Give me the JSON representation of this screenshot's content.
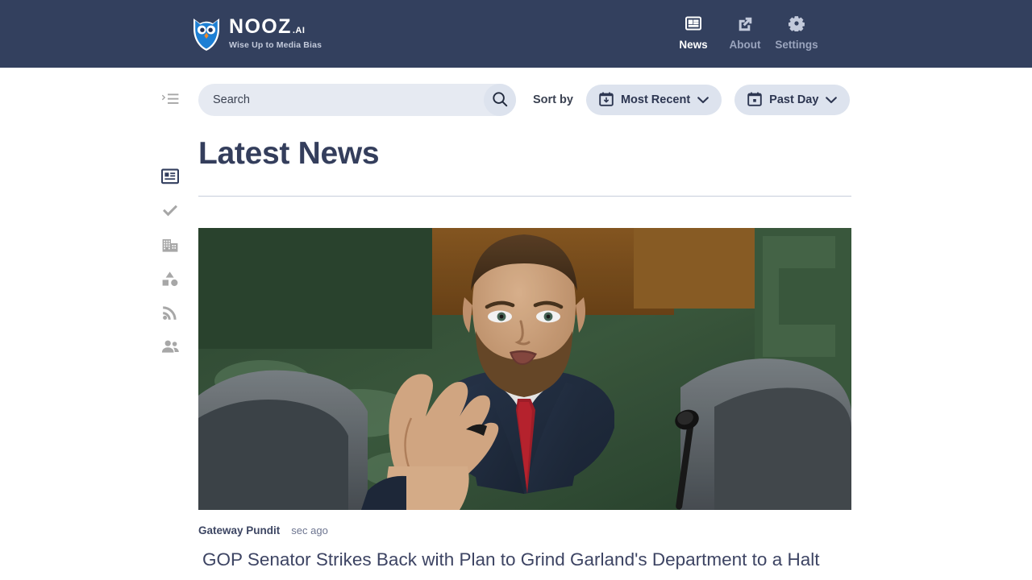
{
  "header": {
    "logo": {
      "icon": "owl-icon",
      "word": "NOOZ",
      "suffix": ".AI",
      "tagline": "Wise Up to Media Bias"
    },
    "nav": [
      {
        "label": "News",
        "icon": "article-feed-icon",
        "active": true
      },
      {
        "label": "About",
        "icon": "external-link-icon",
        "active": false
      },
      {
        "label": "Settings",
        "icon": "gear-icon",
        "active": false
      }
    ]
  },
  "sidebar": {
    "items": [
      {
        "name": "menu-expand",
        "icon": "menu-expand-icon",
        "active": false
      },
      {
        "name": "news",
        "icon": "article-feed-icon",
        "active": true
      },
      {
        "name": "fact-check",
        "icon": "checkmark-icon",
        "active": false
      },
      {
        "name": "organizations",
        "icon": "building-icon",
        "active": false
      },
      {
        "name": "topics",
        "icon": "shapes-icon",
        "active": false
      },
      {
        "name": "feeds",
        "icon": "rss-icon",
        "active": false
      },
      {
        "name": "people",
        "icon": "people-group-icon",
        "active": false
      }
    ]
  },
  "toolbar": {
    "search": {
      "placeholder": "Search",
      "value": "",
      "button_icon": "search-icon"
    },
    "sort_by_label": "Sort by",
    "sort_dropdown": {
      "value": "Most Recent",
      "icon": "calendar-sort-icon",
      "chevron": "chevron-down-icon"
    },
    "date_dropdown": {
      "value": "Past Day",
      "icon": "calendar-icon",
      "chevron": "chevron-down-icon"
    }
  },
  "main": {
    "page_title": "Latest News",
    "articles": [
      {
        "source": "Gateway Pundit",
        "timestamp": "sec ago",
        "headline": "GOP Senator Strikes Back with Plan to Grind Garland's Department to a Halt",
        "image_alt": "bearded-senator-speaking-at-hearing"
      }
    ]
  },
  "colors": {
    "header_bg": "#33405e",
    "accent_navy": "#343e5c",
    "pill_bg": "#dde3ee",
    "search_bg": "#e6eaf2",
    "muted_text": "#6d7590",
    "logo_blue": "#1d7fd4",
    "logo_beak": "#f08a2a"
  }
}
